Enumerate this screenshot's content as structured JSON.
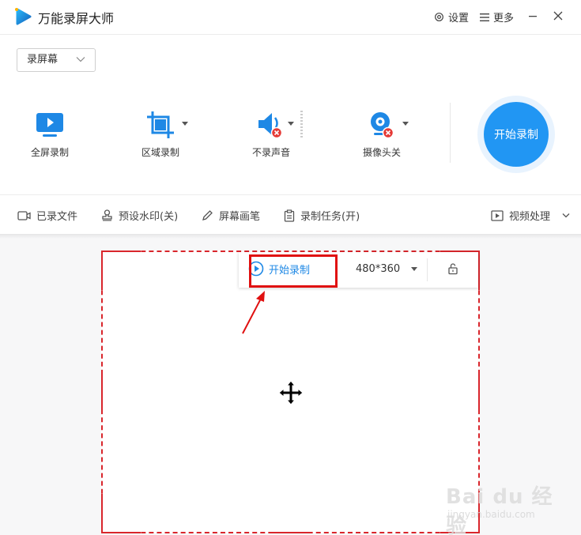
{
  "app": {
    "title": "万能录屏大师"
  },
  "titlebar": {
    "settings_label": "设置",
    "more_label": "更多"
  },
  "mode_select": {
    "value": "录屏幕"
  },
  "tools": [
    {
      "label": "全屏录制",
      "icon": "monitor-play-icon"
    },
    {
      "label": "区域录制",
      "icon": "crop-icon"
    },
    {
      "label": "不录声音",
      "icon": "speaker-muted-icon"
    },
    {
      "label": "摄像头关",
      "icon": "webcam-off-icon"
    }
  ],
  "start_button": {
    "label": "开始录制"
  },
  "bottom_bar": {
    "recorded_files": "已录文件",
    "preset_watermark": "预设水印(关)",
    "screen_pen": "屏幕画笔",
    "record_task": "录制任务(开)",
    "video_processing": "视频处理"
  },
  "region_toolbar": {
    "start_label": "开始录制",
    "size_value": "480*360"
  },
  "watermark": {
    "text": "Bai du 经验",
    "sub": "jingyan.baidu.com"
  },
  "colors": {
    "accent": "#2196f3",
    "region_border": "#d9262c",
    "highlight": "#e01010",
    "muted_badge": "#e53935"
  }
}
